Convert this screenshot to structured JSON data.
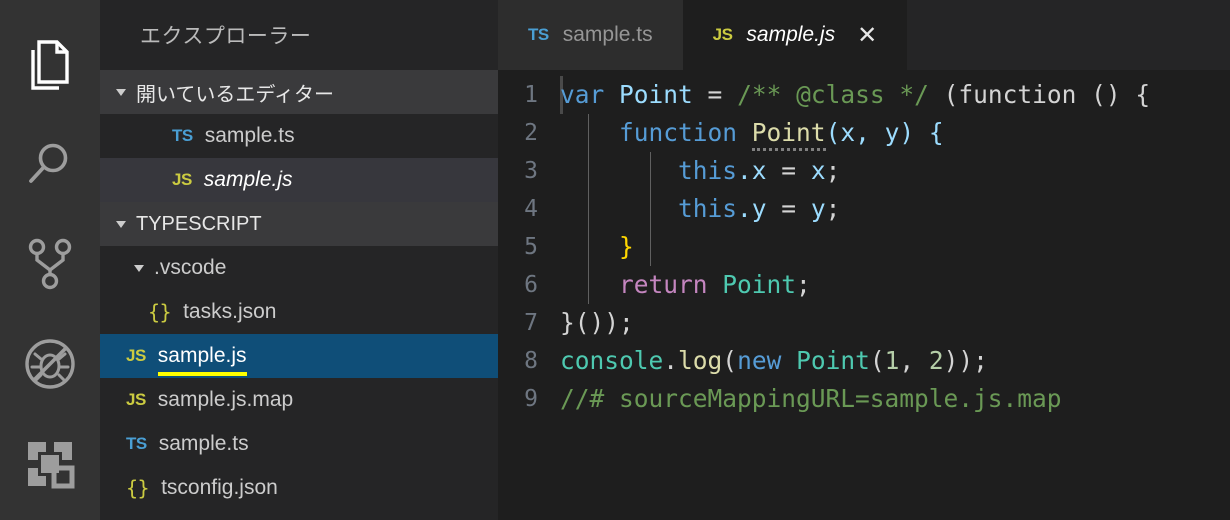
{
  "activity_bar": {
    "items": [
      {
        "name": "explorer",
        "icon": "files-icon",
        "active": true
      },
      {
        "name": "search",
        "icon": "search-icon",
        "active": false
      },
      {
        "name": "source-control",
        "icon": "source-control-icon",
        "active": false
      },
      {
        "name": "debug",
        "icon": "debug-disabled-icon",
        "active": false
      },
      {
        "name": "extensions",
        "icon": "extensions-icon",
        "active": false
      }
    ]
  },
  "sidebar": {
    "title": "エクスプローラー",
    "open_editors": {
      "header": "開いているエディター",
      "items": [
        {
          "icon": "TS",
          "icon_kind": "ts",
          "label": "sample.ts",
          "active": false,
          "italic": false
        },
        {
          "icon": "JS",
          "icon_kind": "js",
          "label": "sample.js",
          "active": true,
          "italic": true
        }
      ]
    },
    "project": {
      "header": "TYPESCRIPT",
      "items": [
        {
          "kind": "folder",
          "label": ".vscode",
          "expanded": true
        },
        {
          "icon": "{}",
          "icon_kind": "json",
          "label": "tasks.json",
          "selected": false
        },
        {
          "icon": "JS",
          "icon_kind": "js",
          "label": "sample.js",
          "selected": true,
          "underline": true
        },
        {
          "icon": "JS",
          "icon_kind": "js",
          "label": "sample.js.map",
          "selected": false
        },
        {
          "icon": "TS",
          "icon_kind": "ts",
          "label": "sample.ts",
          "selected": false
        },
        {
          "icon": "{}",
          "icon_kind": "json",
          "label": "tsconfig.json",
          "selected": false
        }
      ]
    }
  },
  "tabs": [
    {
      "icon": "TS",
      "icon_kind": "ts",
      "label": "sample.ts",
      "active": false,
      "italic": false,
      "close": ""
    },
    {
      "icon": "JS",
      "icon_kind": "js",
      "label": "sample.js",
      "active": true,
      "italic": true,
      "close": "✕"
    }
  ],
  "editor": {
    "language": "javascript",
    "line_numbers": [
      "1",
      "2",
      "3",
      "4",
      "5",
      "6",
      "7",
      "8",
      "9"
    ],
    "lines": [
      "var Point = /** @class */ (function () {",
      "    function Point(x, y) {",
      "        this.x = x;",
      "        this.y = y;",
      "    }",
      "    return Point;",
      "}());",
      "console.log(new Point(1, 2));",
      "//# sourceMappingURL=sample.js.map"
    ],
    "tokens": {
      "l1": {
        "kw_var": "var",
        "name": "Point",
        "eq": " = ",
        "comment": "/** @class */",
        "rest": " (function () {"
      },
      "l2": {
        "indent": "    ",
        "kw": "function",
        "fname": "Point",
        "params": "(x, y) {"
      },
      "l3": {
        "indent": "        ",
        "kw_this": "this",
        "prop": ".x",
        "eq": " = ",
        "val": "x",
        "semi": ";"
      },
      "l4": {
        "indent": "        ",
        "kw_this": "this",
        "prop": ".y",
        "eq": " = ",
        "val": "y",
        "semi": ";"
      },
      "l5": {
        "indent": "    ",
        "brace": "}"
      },
      "l6": {
        "indent": "    ",
        "kw_return": "return",
        "type": " Point",
        "semi": ";"
      },
      "l7": {
        "text": "}());"
      },
      "l8": {
        "obj": "console",
        "dot": ".",
        "method": "log",
        "p1": "(",
        "kw_new": "new",
        "type": " Point",
        "p2": "(",
        "n1": "1",
        "comma": ", ",
        "n2": "2",
        "p3": "));"
      },
      "l9": {
        "comment": "//# sourceMappingURL=sample.js.map"
      }
    }
  },
  "colors": {
    "activity_bar_bg": "#333333",
    "sidebar_bg": "#252526",
    "section_header_bg": "#3a3a3c",
    "selected_row_bg": "#0f4e78",
    "active_open_editor_bg": "#37373d",
    "editor_bg": "#1e1e1e",
    "inactive_tab_bg": "#2d2d2d",
    "underline_accent": "#ffff00",
    "keyword": "#569cd6",
    "variable": "#9cdcfe",
    "comment": "#6a9955",
    "function": "#dcdcaa",
    "type": "#4ec9b0",
    "control": "#c586c0",
    "number": "#b5cea8",
    "ts_icon": "#4a9fd4",
    "js_icon": "#cbcb41"
  }
}
